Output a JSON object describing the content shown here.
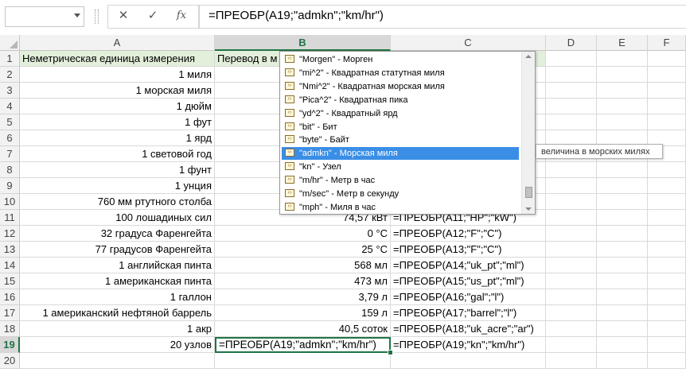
{
  "formula_bar": {
    "name_box": "",
    "cancel_icon": "✕",
    "enter_icon": "✓",
    "fx_label": "fx",
    "formula": "=ПРЕОБР(A19;\"admkn\";\"km/hr\")"
  },
  "columns": [
    "A",
    "B",
    "C",
    "D",
    "E",
    "F"
  ],
  "selected_column": "B",
  "selected_row": 19,
  "rows": [
    {
      "n": "1",
      "a": "Неметрическая единица измерения",
      "b": "Перевод в м",
      "c": ""
    },
    {
      "n": "2",
      "a": "1 миля",
      "b": "",
      "c": ""
    },
    {
      "n": "3",
      "a": "1 морская миля",
      "b": "",
      "c": ""
    },
    {
      "n": "4",
      "a": "1 дюйм",
      "b": "",
      "c": ""
    },
    {
      "n": "5",
      "a": "1 фут",
      "b": "",
      "c": ""
    },
    {
      "n": "6",
      "a": "1 ярд",
      "b": "",
      "c": ""
    },
    {
      "n": "7",
      "a": "1 световой год",
      "b": "",
      "c": ""
    },
    {
      "n": "8",
      "a": "1 фунт",
      "b": "",
      "c": ""
    },
    {
      "n": "9",
      "a": "1 унция",
      "b": "",
      "c": ""
    },
    {
      "n": "10",
      "a": "760 мм ртутного столба",
      "b": "",
      "c": ""
    },
    {
      "n": "11",
      "a": "100 лошадиных сил",
      "b": "74,57 кВт",
      "c": "=ПРЕОБР(A11;\"HP\";\"kW\")"
    },
    {
      "n": "12",
      "a": "32 градуса Фаренгейта",
      "b": "0 °C",
      "c": "=ПРЕОБР(A12;\"F\";\"C\")"
    },
    {
      "n": "13",
      "a": "77 градусов Фаренгейта",
      "b": "25 °C",
      "c": "=ПРЕОБР(A13;\"F\";\"C\")"
    },
    {
      "n": "14",
      "a": "1 английская пинта",
      "b": "568 мл",
      "c": "=ПРЕОБР(A14;\"uk_pt\";\"ml\")"
    },
    {
      "n": "15",
      "a": "1 американская пинта",
      "b": "473 мл",
      "c": "=ПРЕОБР(A15;\"us_pt\";\"ml\")"
    },
    {
      "n": "16",
      "a": "1 галлон",
      "b": "3,79 л",
      "c": "=ПРЕОБР(A16;\"gal\";\"l\")"
    },
    {
      "n": "17",
      "a": "1 американский нефтяной баррель",
      "b": "159 л",
      "c": "=ПРЕОБР(A17;\"barrel\";\"l\")"
    },
    {
      "n": "18",
      "a": "1 акр",
      "b": "40,5 соток",
      "c": "=ПРЕОБР(A18;\"uk_acre\";\"ar\")"
    },
    {
      "n": "19",
      "a": "20 узлов",
      "b": "=ПРЕОБР(A19;\"admkn\";\"km/hr\")",
      "c": "=ПРЕОБР(A19;\"kn\";\"km/hr\")"
    },
    {
      "n": "20",
      "a": "",
      "b": "",
      "c": ""
    }
  ],
  "autocomplete": {
    "items": [
      "\"Morgen\" - Морген",
      "\"mi^2\" - Квадратная статутная миля",
      "\"Nmi^2\" - Квадратная морская миля",
      "\"Pica^2\" - Квадратная пика",
      "\"yd^2\" - Квадратный ярд",
      "\"bit\" - Бит",
      "\"byte\" - Байт",
      "\"admkn\" - Морская миля",
      "\"kn\" - Узел",
      "\"m/hr\" - Метр в час",
      "\"m/sec\" - Метр в секунду",
      "\"mph\" - Миля в час"
    ],
    "selected_index": 7,
    "icon": "function-icon",
    "tooltip": "величина в морских милях"
  }
}
